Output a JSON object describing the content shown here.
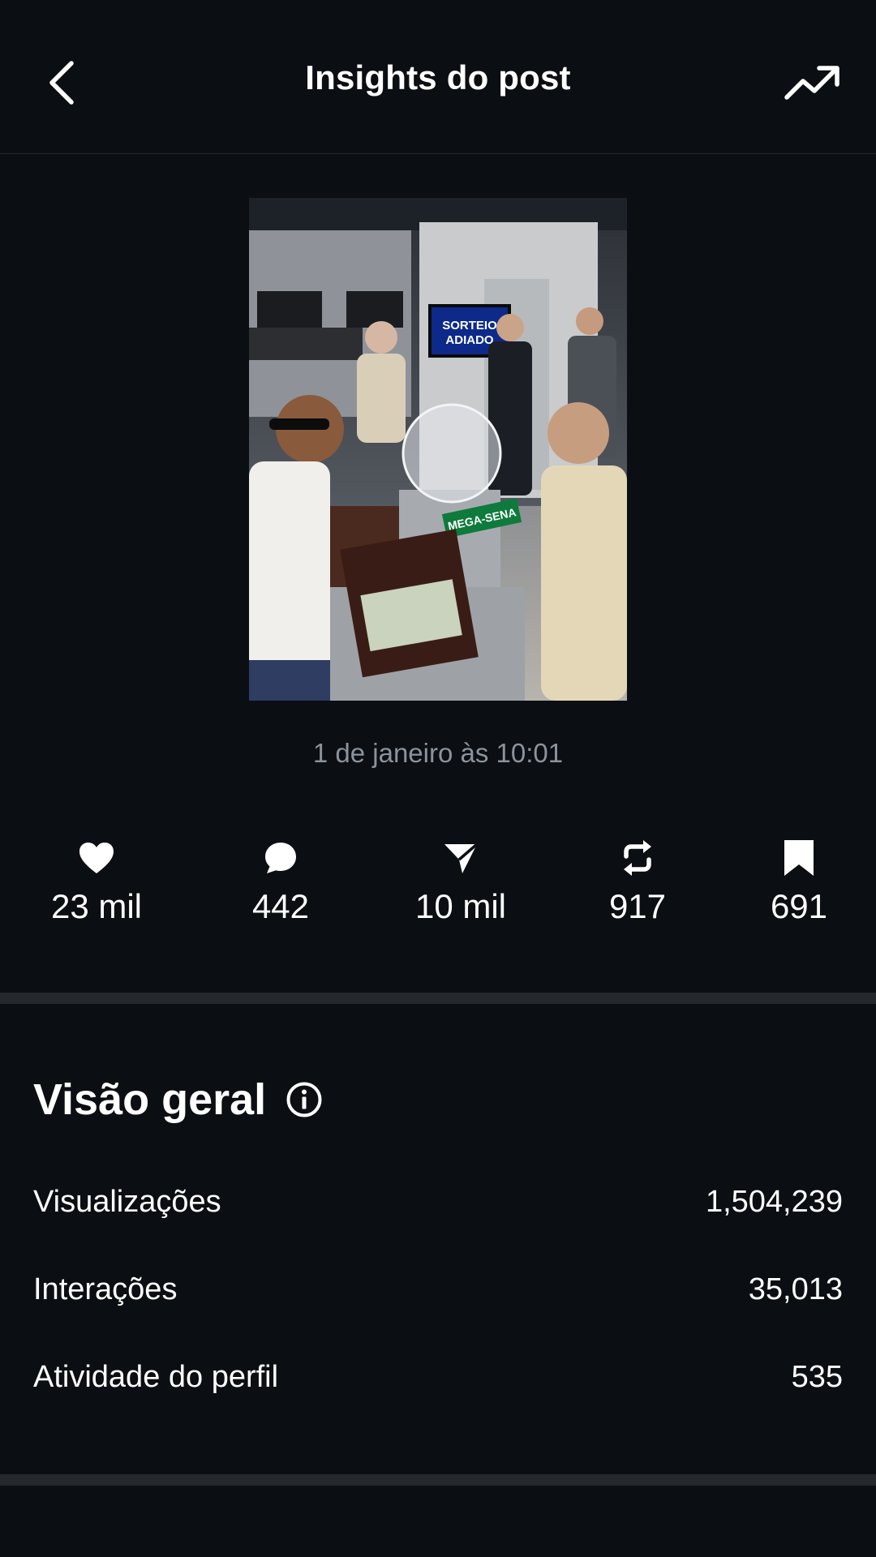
{
  "header": {
    "title": "Insights do post",
    "back_icon": "chevron-left-icon",
    "trend_icon": "trending-up-icon"
  },
  "post": {
    "image_alt": "Foto do post",
    "image_text": {
      "screen_line1": "SORTEIO",
      "screen_line2": "ADIADO",
      "banner": "MEGA-SENA"
    },
    "timestamp": "1 de janeiro às 10:01"
  },
  "stats": [
    {
      "icon": "heart-icon",
      "value": "23 mil"
    },
    {
      "icon": "comment-icon",
      "value": "442"
    },
    {
      "icon": "send-icon",
      "value": "10 mil"
    },
    {
      "icon": "repost-icon",
      "value": "917"
    },
    {
      "icon": "bookmark-icon",
      "value": "691"
    }
  ],
  "overview": {
    "title": "Visão geral",
    "info_icon": "info-icon",
    "rows": [
      {
        "label": "Visualizações",
        "value": "1,504,239"
      },
      {
        "label": "Interações",
        "value": "35,013"
      },
      {
        "label": "Atividade do perfil",
        "value": "535"
      }
    ]
  },
  "colors": {
    "background": "#0b0e12",
    "text": "#ffffff",
    "muted": "#8b939c",
    "divider": "#25292e"
  }
}
